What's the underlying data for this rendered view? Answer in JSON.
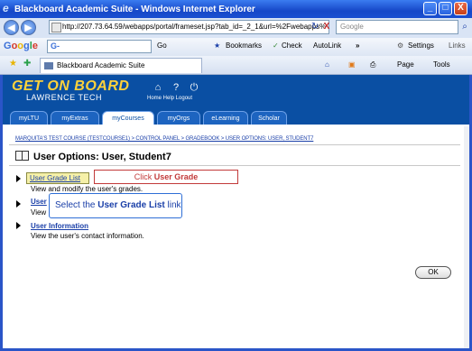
{
  "window": {
    "title": "Blackboard Academic Suite - Windows Internet Explorer",
    "minimize": "_",
    "maximize": "□",
    "close": "X"
  },
  "addressbar": {
    "back": "◀",
    "forward": "▶",
    "url": "http://207.73.64.59/webapps/portal/frameset.jsp?tab_id=_2_1&url=%2Fwebapps%",
    "search_placeholder": "Google",
    "refresh": "↻",
    "stop": "X"
  },
  "google_toolbar": {
    "logo": "Google",
    "g_label": "G-",
    "go": "Go",
    "bookmarks": "Bookmarks",
    "check": "Check",
    "autolink": "AutoLink",
    "more": "»",
    "settings": "Settings",
    "links": "Links"
  },
  "tabs": {
    "active_tab": "Blackboard Academic Suite",
    "page": "Page",
    "tools": "Tools"
  },
  "banner": {
    "brand_line1": "GET ON BOARD",
    "brand_line2": "LAWRENCE TECH",
    "header_links": "Home  Help  Logout",
    "nav": [
      {
        "label": "myLTU"
      },
      {
        "label": "myExtras"
      },
      {
        "label": "myCourses"
      },
      {
        "label": "myOrgs"
      },
      {
        "label": "eLearning"
      },
      {
        "label": "Scholar"
      }
    ]
  },
  "breadcrumb": "MARQUITA'S TEST COURSE (TESTCOURSE1) > CONTROL PANEL > GRADEBOOK > USER OPTIONS: USER, STUDENT7",
  "page_title": "User Options: User, Student7",
  "options": [
    {
      "link": "User Grade List",
      "desc": "View and modify the user's grades."
    },
    {
      "link": "User",
      "desc": "View"
    },
    {
      "link": "User Information",
      "desc": "View the user's contact information."
    }
  ],
  "callouts": {
    "click_prefix": "Click ",
    "click_target": "User Grade",
    "select_prefix": "Select the ",
    "select_target": "User Grade List",
    "select_suffix": " link"
  },
  "ok_button": "OK"
}
